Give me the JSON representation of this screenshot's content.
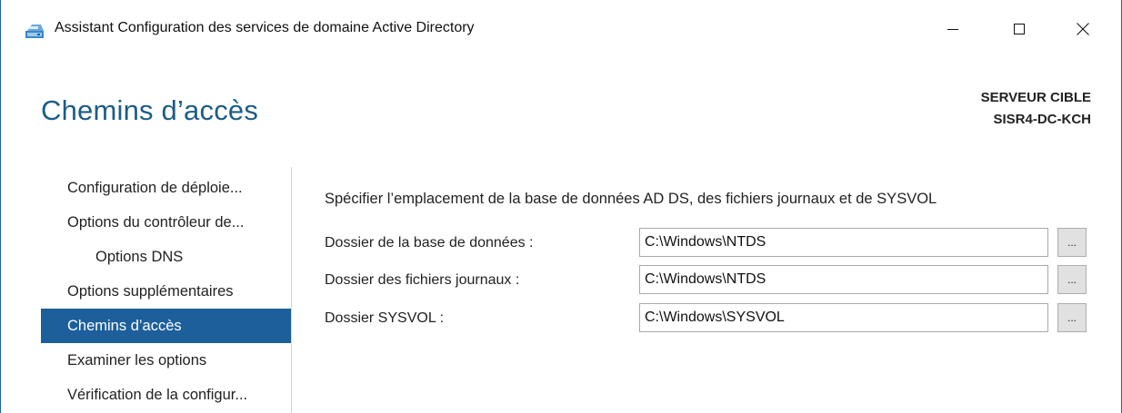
{
  "window": {
    "title": "Assistant Configuration des services de domaine Active Directory",
    "icon": "ad-ds-wizard-icon"
  },
  "header": {
    "page_title": "Chemins d’accès",
    "target_label": "SERVEUR CIBLE",
    "target_server": "SISR4-DC-KCH"
  },
  "nav": {
    "items": [
      {
        "label": "Configuration de déploie..."
      },
      {
        "label": "Options du contrôleur de..."
      },
      {
        "label": "Options DNS"
      },
      {
        "label": "Options supplémentaires"
      },
      {
        "label": "Chemins d’accès"
      },
      {
        "label": "Examiner les options"
      },
      {
        "label": "Vérification de la configur..."
      }
    ],
    "active_index": 4
  },
  "main": {
    "instruction": "Spécifier l’emplacement de la base de données AD DS, des fichiers journaux et de SYSVOL",
    "fields": [
      {
        "label": "Dossier de la base de données :",
        "value": "C:\\Windows\\NTDS",
        "browse_label": "..."
      },
      {
        "label": "Dossier des fichiers journaux :",
        "value": "C:\\Windows\\NTDS",
        "browse_label": "..."
      },
      {
        "label": "Dossier SYSVOL :",
        "value": "C:\\Windows\\SYSVOL",
        "browse_label": "..."
      }
    ]
  },
  "colors": {
    "accent": "#1c5f9b",
    "title": "#1c5d87",
    "border": "#1f5fa8"
  }
}
